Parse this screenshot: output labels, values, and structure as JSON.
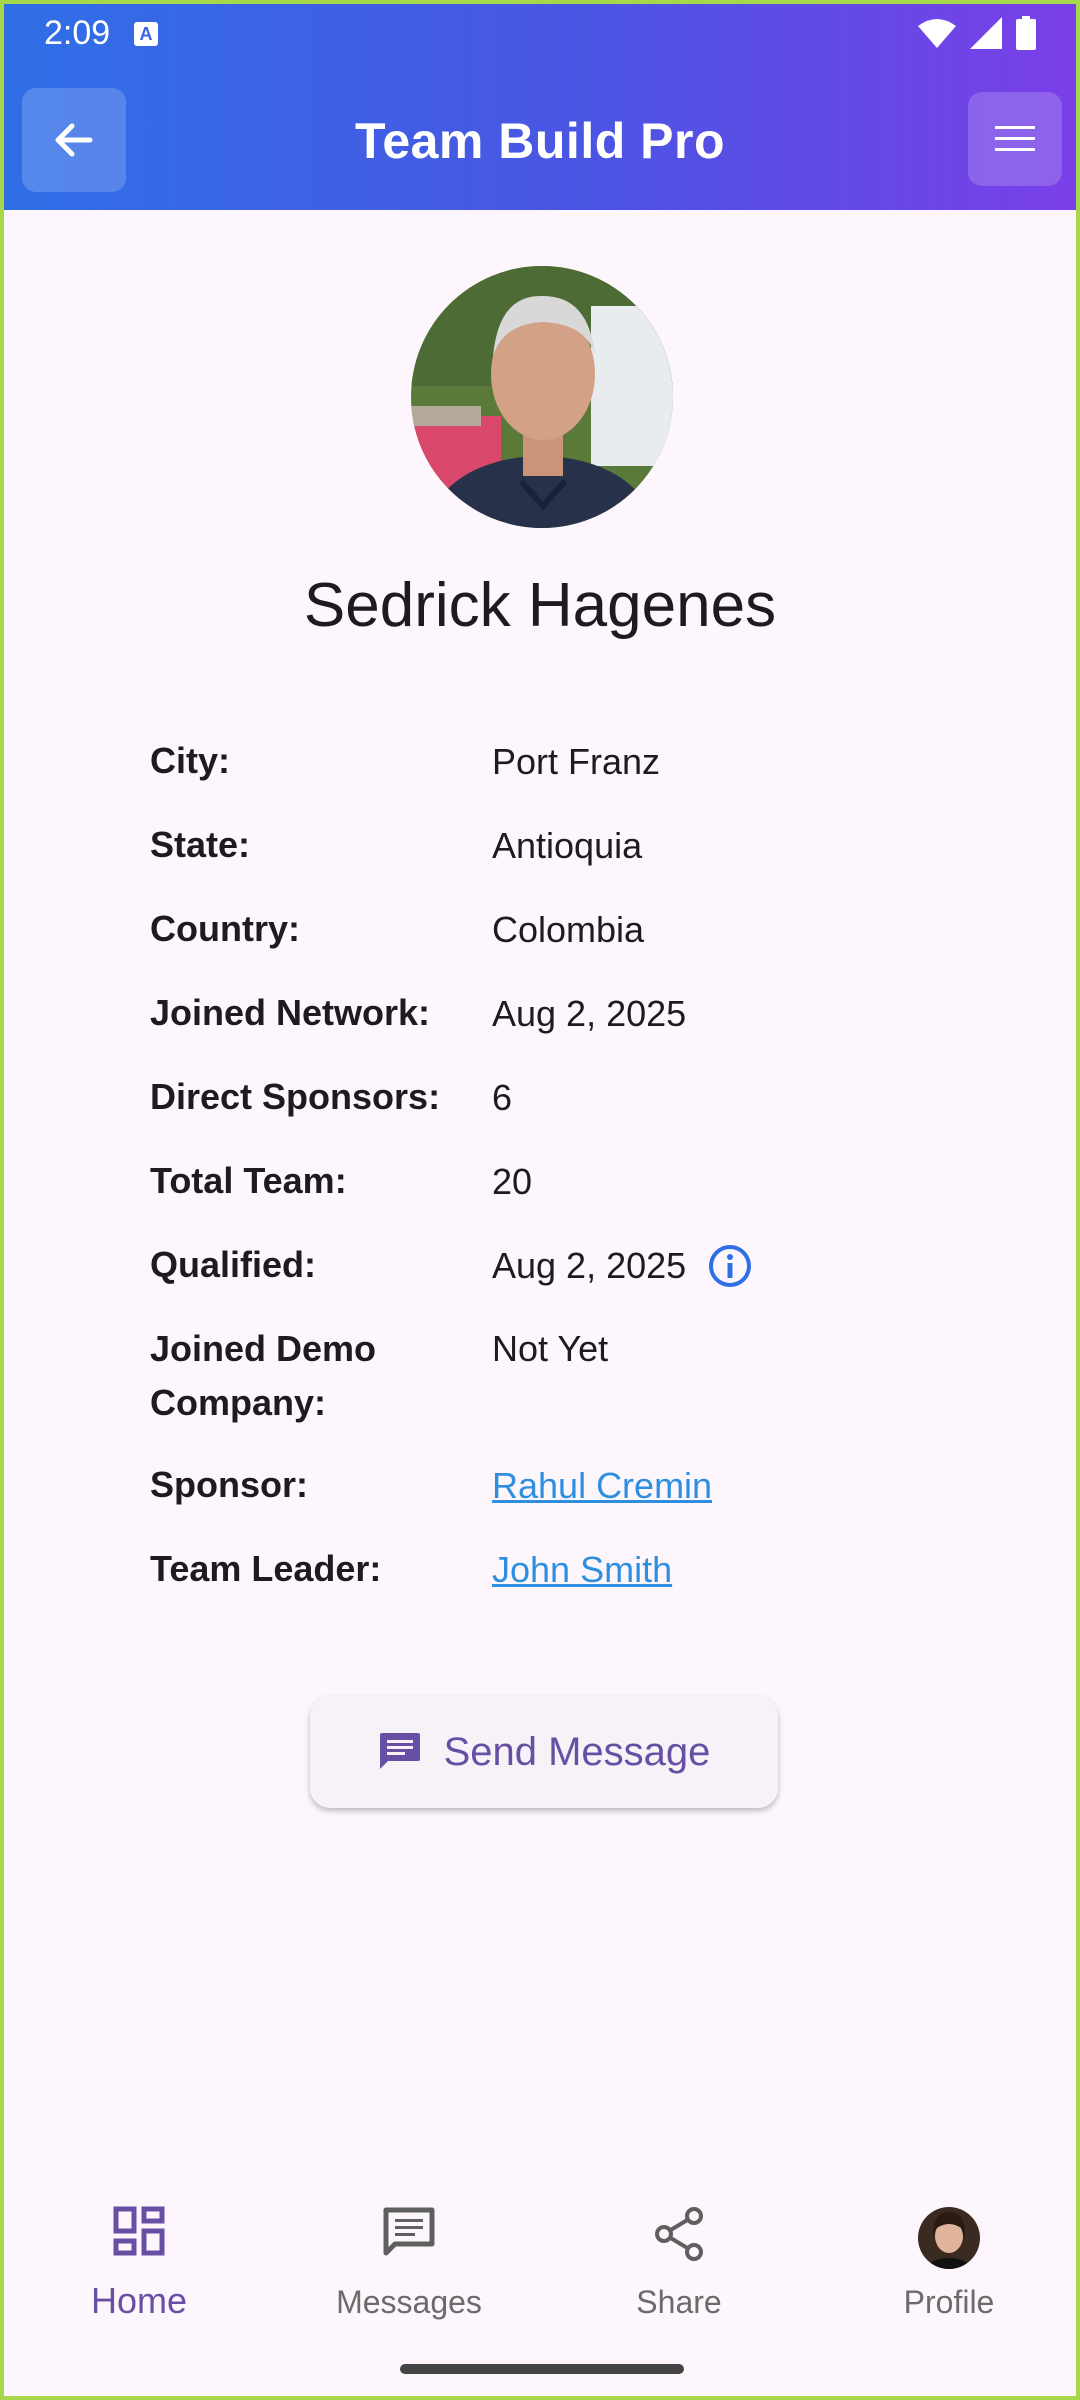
{
  "status_bar": {
    "time": "2:09",
    "notification_icon": "a-icon"
  },
  "appbar": {
    "title": "Team Build Pro",
    "back_icon": "arrow-left-icon",
    "menu_icon": "hamburger-menu-icon"
  },
  "profile": {
    "name": "Sedrick Hagenes",
    "fields": [
      {
        "label": "City:",
        "value": "Port Franz"
      },
      {
        "label": "State:",
        "value": "Antioquia"
      },
      {
        "label": "Country:",
        "value": "Colombia"
      },
      {
        "label": "Joined Network:",
        "value": "Aug 2, 2025"
      },
      {
        "label": "Direct Sponsors:",
        "value": "6"
      },
      {
        "label": "Total Team:",
        "value": "20"
      },
      {
        "label": "Qualified:",
        "value": "Aug 2, 2025"
      },
      {
        "label": "Joined Demo Company:",
        "value": "Not Yet"
      },
      {
        "label": "Sponsor:",
        "value": "Rahul Cremin"
      },
      {
        "label": "Team Leader:",
        "value": "John Smith"
      }
    ]
  },
  "actions": {
    "send_message": "Send Message"
  },
  "bottom_nav": {
    "items": [
      {
        "label": "Home",
        "icon": "dashboard-icon",
        "active": true
      },
      {
        "label": "Messages",
        "icon": "message-icon",
        "active": false
      },
      {
        "label": "Share",
        "icon": "share-icon",
        "active": false
      },
      {
        "label": "Profile",
        "icon": "avatar",
        "active": false
      }
    ]
  },
  "colors": {
    "header_start": "#2f6fe6",
    "header_end": "#7a3fe8",
    "accent": "#6750a4",
    "link": "#2e8fe0",
    "info": "#2f6fe6"
  }
}
